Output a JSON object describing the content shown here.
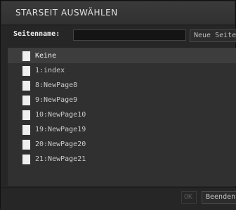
{
  "dialog": {
    "title": "STARSEIT AUSWÄHLEN"
  },
  "name_row": {
    "label": "Seitenname:",
    "input_value": "",
    "new_page_button": "Neue Seite"
  },
  "list": {
    "items": [
      {
        "label": "Keine",
        "selected": true
      },
      {
        "label": "1:index"
      },
      {
        "label": "8:NewPage8"
      },
      {
        "label": "9:NewPage9"
      },
      {
        "label": "10:NewPage10"
      },
      {
        "label": "19:NewPage19"
      },
      {
        "label": "20:NewPage20"
      },
      {
        "label": "21:NewPage21"
      }
    ]
  },
  "footer": {
    "ok_button": "OK",
    "end_button": "Beenden"
  }
}
